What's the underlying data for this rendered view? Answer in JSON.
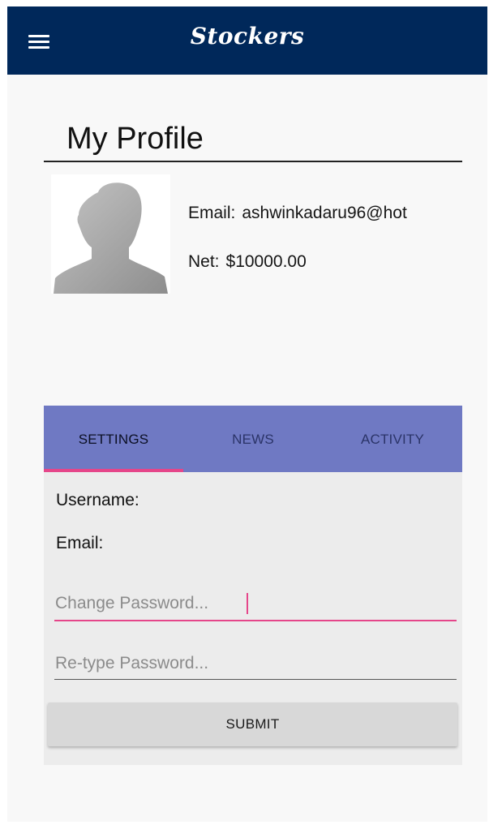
{
  "app": {
    "title": "Stockers",
    "header_color": "#00285a"
  },
  "profile": {
    "heading": "My Profile",
    "email_label": "Email:",
    "email_value": "ashwinkadaru96@hot",
    "net_label": "Net:",
    "net_value": "$10000.00"
  },
  "tabs": [
    {
      "label": "SETTINGS",
      "active": true
    },
    {
      "label": "NEWS",
      "active": false
    },
    {
      "label": "ACTIVITY",
      "active": false
    }
  ],
  "settings": {
    "username_label": "Username:",
    "email_label": "Email:",
    "change_password_placeholder": "Change Password...",
    "retype_password_placeholder": "Re-type Password...",
    "submit_label": "SUBMIT"
  },
  "colors": {
    "tab_bar": "#6f79c3",
    "accent": "#e5468a",
    "card_background": "#ececec"
  },
  "icons": {
    "menu": "hamburger-menu-icon",
    "avatar": "user-silhouette-icon"
  }
}
